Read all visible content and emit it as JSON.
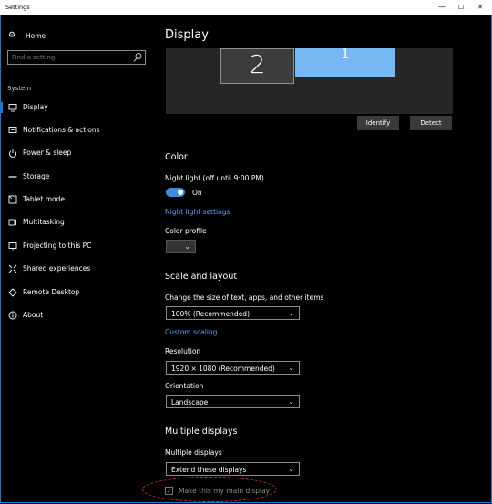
{
  "window": {
    "title": "Settings",
    "minimize": "—",
    "maximize": "☐",
    "close": "✕",
    "accent": "#1e78c8"
  },
  "sidebar": {
    "home_label": "Home",
    "search_placeholder": "Find a setting",
    "section": "System",
    "items": [
      {
        "label": "Display",
        "icon": "monitor-icon",
        "active": true
      },
      {
        "label": "Notifications & actions",
        "icon": "notification-icon"
      },
      {
        "label": "Power & sleep",
        "icon": "power-icon"
      },
      {
        "label": "Storage",
        "icon": "storage-icon"
      },
      {
        "label": "Tablet mode",
        "icon": "tablet-icon"
      },
      {
        "label": "Multitasking",
        "icon": "multitasking-icon"
      },
      {
        "label": "Projecting to this PC",
        "icon": "projecting-icon"
      },
      {
        "label": "Shared experiences",
        "icon": "shared-icon"
      },
      {
        "label": "Remote Desktop",
        "icon": "remote-icon"
      },
      {
        "label": "About",
        "icon": "info-icon"
      }
    ]
  },
  "main": {
    "title": "Display",
    "monitors": {
      "secondary": "2",
      "primary": "1"
    },
    "identify_label": "Identify",
    "detect_label": "Detect",
    "color": {
      "heading": "Color",
      "night_light_label": "Night light (off until 9:00 PM)",
      "night_light_state": "On",
      "night_light_settings": "Night light settings",
      "color_profile_label": "Color profile"
    },
    "scale": {
      "heading": "Scale and layout",
      "size_label": "Change the size of text, apps, and other items",
      "size_value": "100% (Recommended)",
      "custom_scaling": "Custom scaling",
      "resolution_label": "Resolution",
      "resolution_value": "1920 × 1080 (Recommended)",
      "orientation_label": "Orientation",
      "orientation_value": "Landscape"
    },
    "multiple": {
      "heading": "Multiple displays",
      "label": "Multiple displays",
      "value": "Extend these displays",
      "main_display_checkbox": "Make this my main display"
    }
  }
}
